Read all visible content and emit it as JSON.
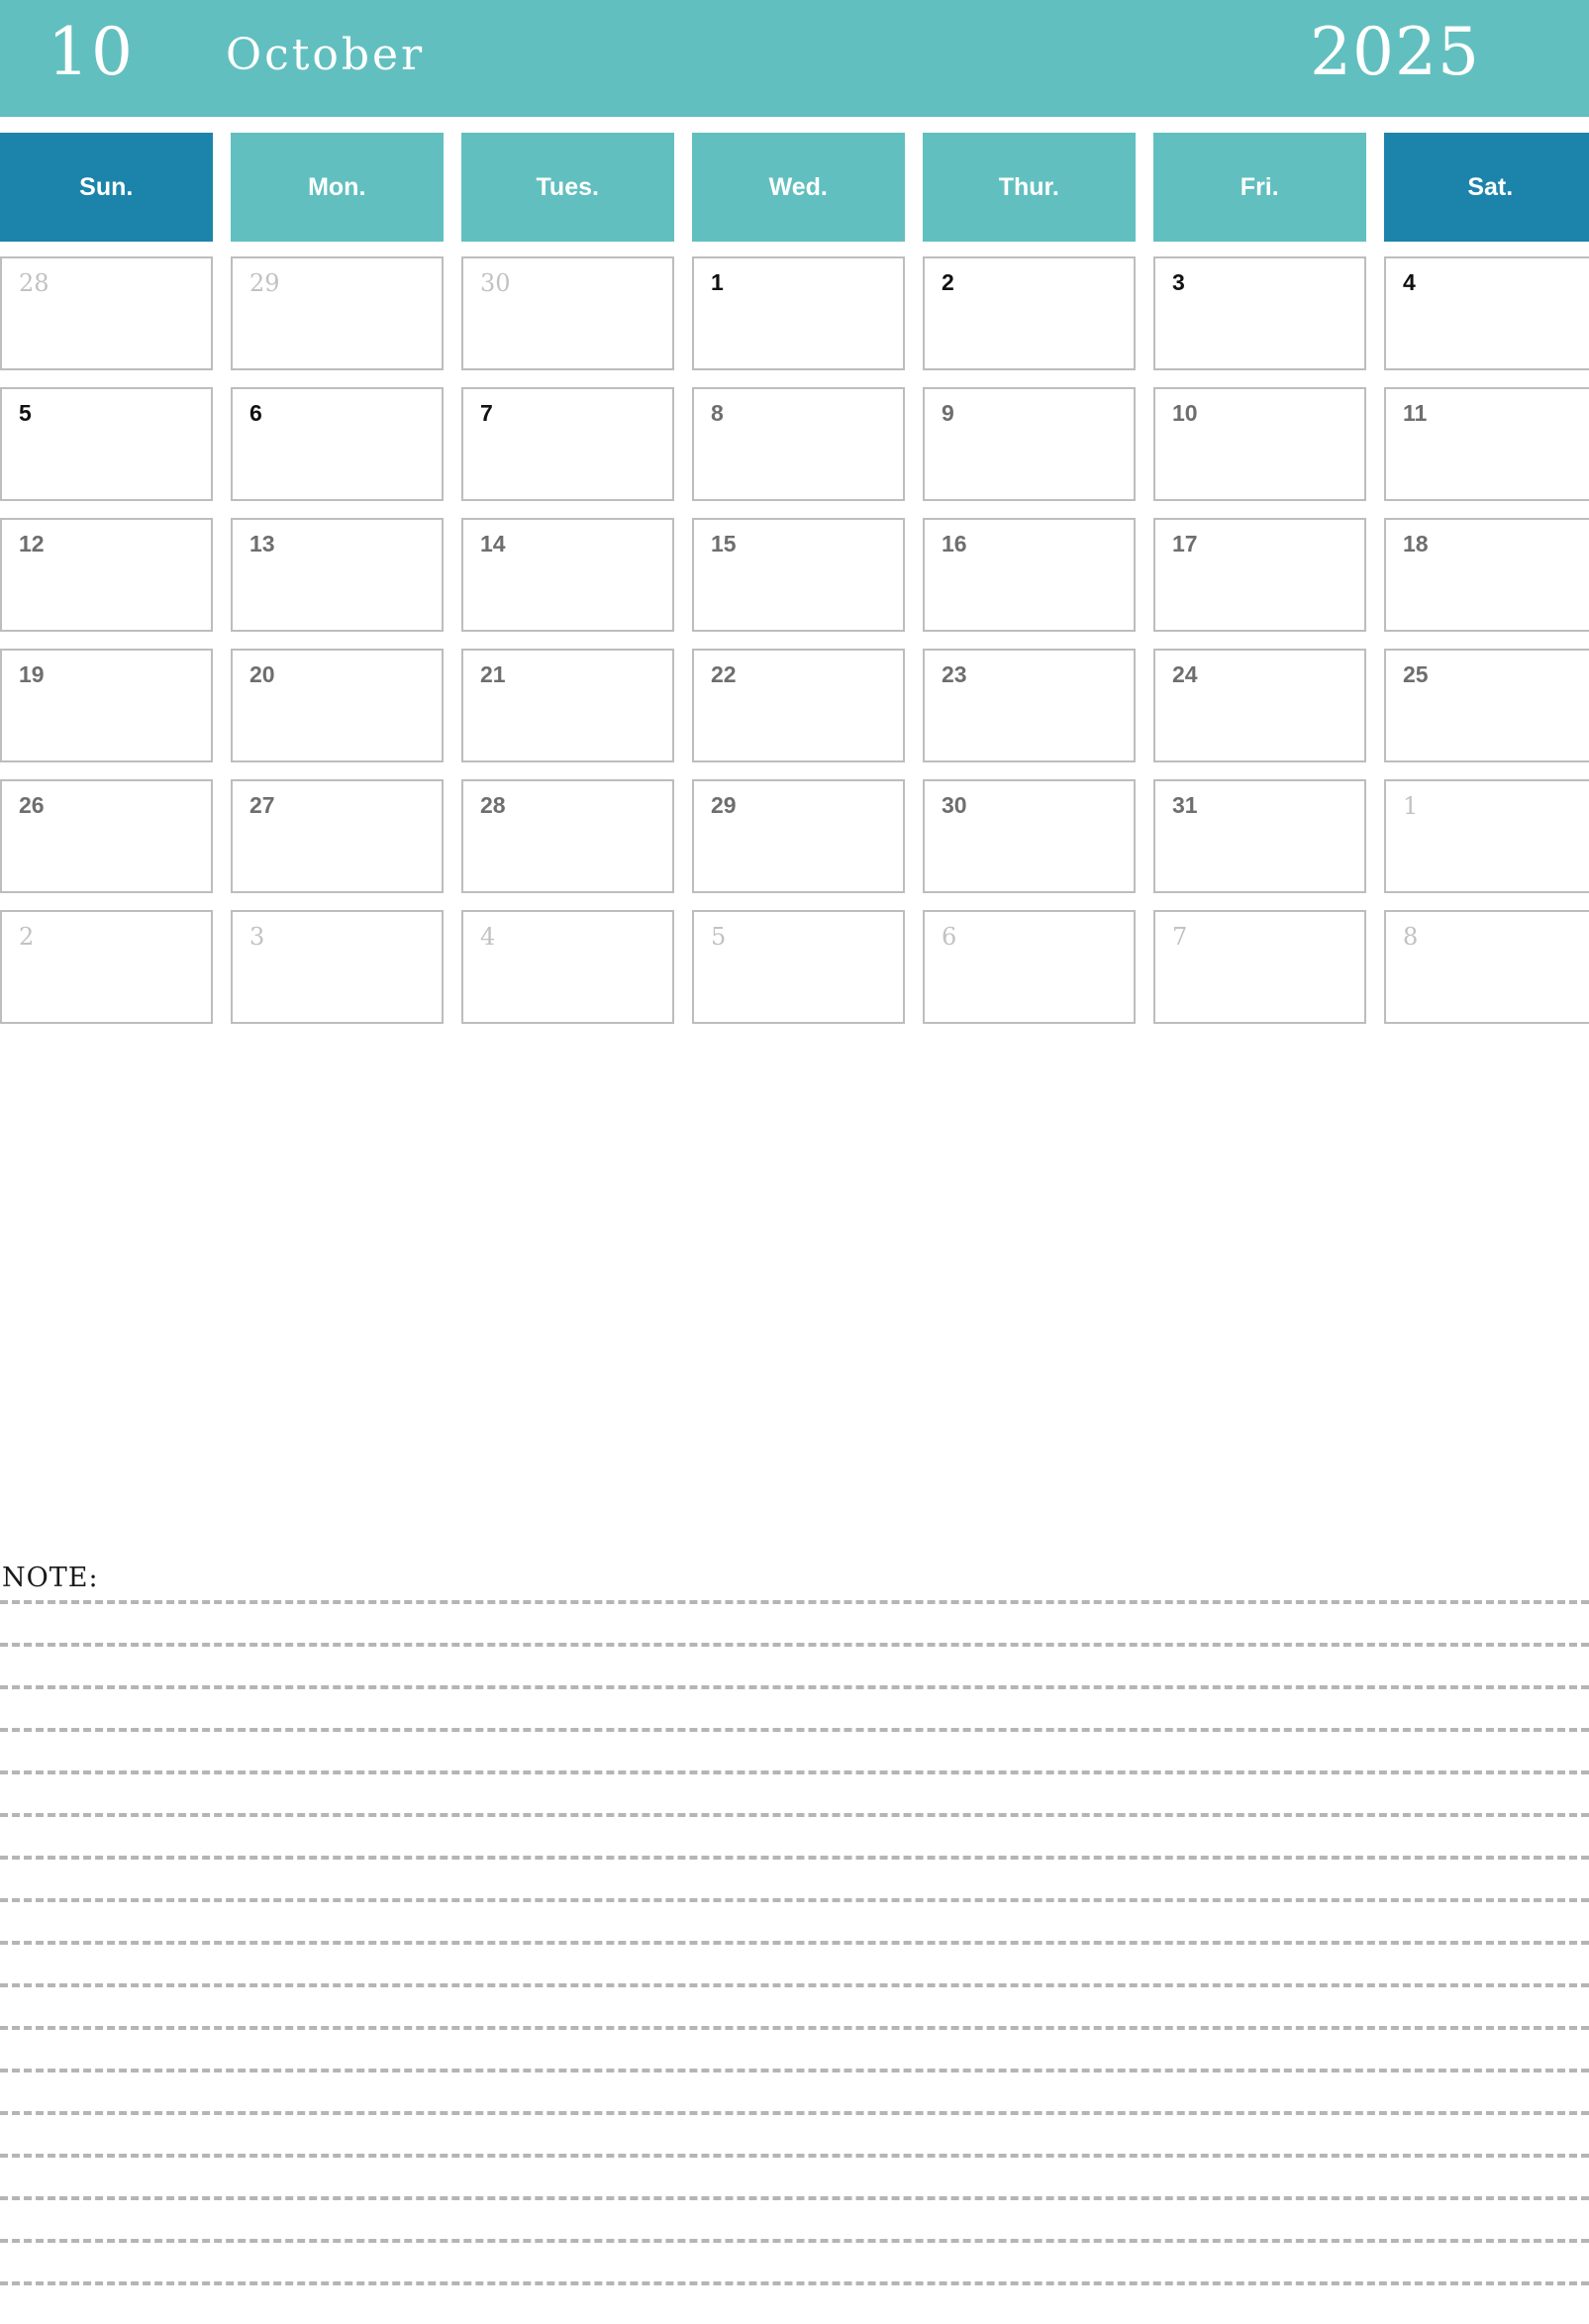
{
  "header": {
    "month_number": "10",
    "month_name": "October",
    "year": "2025",
    "band_color": "#62bfbf"
  },
  "weekdays": [
    {
      "label": "Sun.",
      "weekend": true
    },
    {
      "label": "Mon.",
      "weekend": false
    },
    {
      "label": "Tues.",
      "weekend": false
    },
    {
      "label": "Wed.",
      "weekend": false
    },
    {
      "label": "Thur.",
      "weekend": false
    },
    {
      "label": "Fri.",
      "weekend": false
    },
    {
      "label": "Sat.",
      "weekend": true
    }
  ],
  "colors": {
    "teal": "#62bfbf",
    "weekend_blue": "#1c84ab",
    "cell_border": "#bdbdbd",
    "day_text": "#6e6e6e",
    "day_text_dark": "#111111",
    "other_month_text": "#c2c2c2",
    "note_line": "#b5b5b5"
  },
  "weeks": [
    [
      {
        "day": "28",
        "in_month": false,
        "emphasis": false
      },
      {
        "day": "29",
        "in_month": false,
        "emphasis": false
      },
      {
        "day": "30",
        "in_month": false,
        "emphasis": false
      },
      {
        "day": "1",
        "in_month": true,
        "emphasis": true
      },
      {
        "day": "2",
        "in_month": true,
        "emphasis": true
      },
      {
        "day": "3",
        "in_month": true,
        "emphasis": true
      },
      {
        "day": "4",
        "in_month": true,
        "emphasis": true
      }
    ],
    [
      {
        "day": "5",
        "in_month": true,
        "emphasis": true
      },
      {
        "day": "6",
        "in_month": true,
        "emphasis": true
      },
      {
        "day": "7",
        "in_month": true,
        "emphasis": true
      },
      {
        "day": "8",
        "in_month": true,
        "emphasis": false
      },
      {
        "day": "9",
        "in_month": true,
        "emphasis": false
      },
      {
        "day": "10",
        "in_month": true,
        "emphasis": false
      },
      {
        "day": "11",
        "in_month": true,
        "emphasis": false
      }
    ],
    [
      {
        "day": "12",
        "in_month": true,
        "emphasis": false
      },
      {
        "day": "13",
        "in_month": true,
        "emphasis": false
      },
      {
        "day": "14",
        "in_month": true,
        "emphasis": false
      },
      {
        "day": "15",
        "in_month": true,
        "emphasis": false
      },
      {
        "day": "16",
        "in_month": true,
        "emphasis": false
      },
      {
        "day": "17",
        "in_month": true,
        "emphasis": false
      },
      {
        "day": "18",
        "in_month": true,
        "emphasis": false
      }
    ],
    [
      {
        "day": "19",
        "in_month": true,
        "emphasis": false
      },
      {
        "day": "20",
        "in_month": true,
        "emphasis": false
      },
      {
        "day": "21",
        "in_month": true,
        "emphasis": false
      },
      {
        "day": "22",
        "in_month": true,
        "emphasis": false
      },
      {
        "day": "23",
        "in_month": true,
        "emphasis": false
      },
      {
        "day": "24",
        "in_month": true,
        "emphasis": false
      },
      {
        "day": "25",
        "in_month": true,
        "emphasis": false
      }
    ],
    [
      {
        "day": "26",
        "in_month": true,
        "emphasis": false
      },
      {
        "day": "27",
        "in_month": true,
        "emphasis": false
      },
      {
        "day": "28",
        "in_month": true,
        "emphasis": false
      },
      {
        "day": "29",
        "in_month": true,
        "emphasis": false
      },
      {
        "day": "30",
        "in_month": true,
        "emphasis": false
      },
      {
        "day": "31",
        "in_month": true,
        "emphasis": false
      },
      {
        "day": "1",
        "in_month": false,
        "emphasis": false
      }
    ],
    [
      {
        "day": "2",
        "in_month": false,
        "emphasis": false
      },
      {
        "day": "3",
        "in_month": false,
        "emphasis": false
      },
      {
        "day": "4",
        "in_month": false,
        "emphasis": false
      },
      {
        "day": "5",
        "in_month": false,
        "emphasis": false
      },
      {
        "day": "6",
        "in_month": false,
        "emphasis": false
      },
      {
        "day": "7",
        "in_month": false,
        "emphasis": false
      },
      {
        "day": "8",
        "in_month": false,
        "emphasis": false
      }
    ]
  ],
  "note": {
    "label": "NOTE:",
    "line_count": 17
  }
}
